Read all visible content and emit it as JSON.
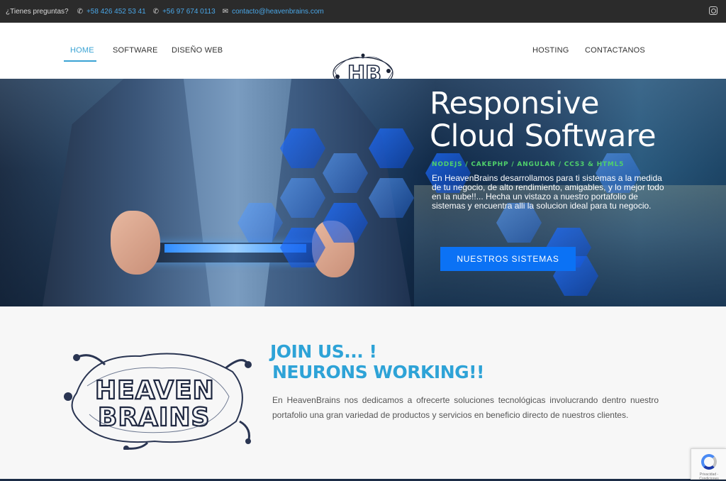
{
  "topbar": {
    "question": "¿Tienes preguntas?",
    "phone1": "+58 426 452 53 41",
    "phone2": "+56 97 674 0113",
    "email": "contacto@heavenbrains.com",
    "phone_icon": "phone-icon",
    "mail_icon": "mail-icon",
    "social_icon": "instagram-icon"
  },
  "nav": {
    "home": "HOME",
    "software": "SOFTWARE",
    "diseno": "DISEÑO WEB",
    "hosting": "HOSTING",
    "contactanos": "CONTACTANOS",
    "logo": "HB"
  },
  "hero": {
    "title_line1": "Responsive",
    "title_line2": "Cloud Software",
    "tech": "NODEJS / CAKEPHP / ANGULAR / CCS3 & HTML5",
    "description": "En HeavenBrains desarrollamos para ti sistemas a la medida de tu negocio, de alto rendimiento, amigables, y lo mejor todo en la nube!!... Hecha un vistazo a nuestro portafolio de sistemas y encuentra alli la solucion ideal para tu negocio.",
    "cta": "NUESTROS SISTEMAS"
  },
  "about": {
    "logo_line1": "HEAVEN",
    "logo_line2": "BRAINS",
    "heading_line1": "JOIN US... !",
    "heading_line2": "NEURONS WORKING!!",
    "text": "En HeavenBrains nos dedicamos a ofrecerte soluciones tecnológicas involucrando dentro nuestro portafolio una gran variedad de productos y servicios en beneficio directo de nuestros clientes."
  },
  "recaptcha": {
    "label": "Privacidad - Condiciones"
  },
  "colors": {
    "accent": "#2ea3d7",
    "cta": "#0b72f5",
    "tech": "#4fd06b",
    "topbar": "#2b2b2b"
  }
}
